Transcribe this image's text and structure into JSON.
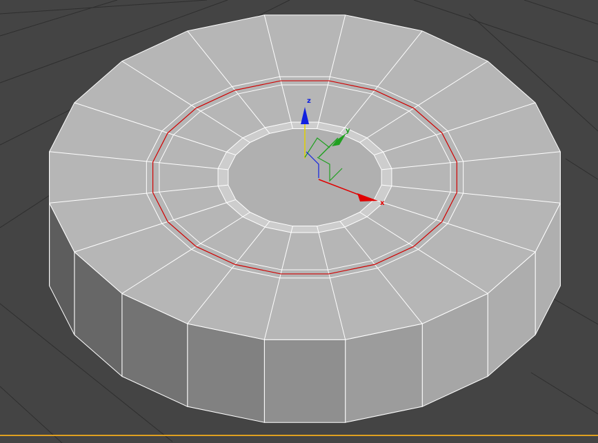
{
  "viewport": {
    "background_color": "#444444",
    "grid_color": "#2c2c2c",
    "mesh_face_color": "#b4b4b4",
    "wire_color": "#ffffff",
    "selection_color": "#d00000",
    "bottom_frame_color": "#e0a020"
  },
  "gizmo": {
    "x_label": "x",
    "y_label": "y",
    "z_label": "z",
    "x_color": "#e00000",
    "y_color": "#20a020",
    "z_color": "#1020e0",
    "pivot_color": "#e0d000"
  }
}
